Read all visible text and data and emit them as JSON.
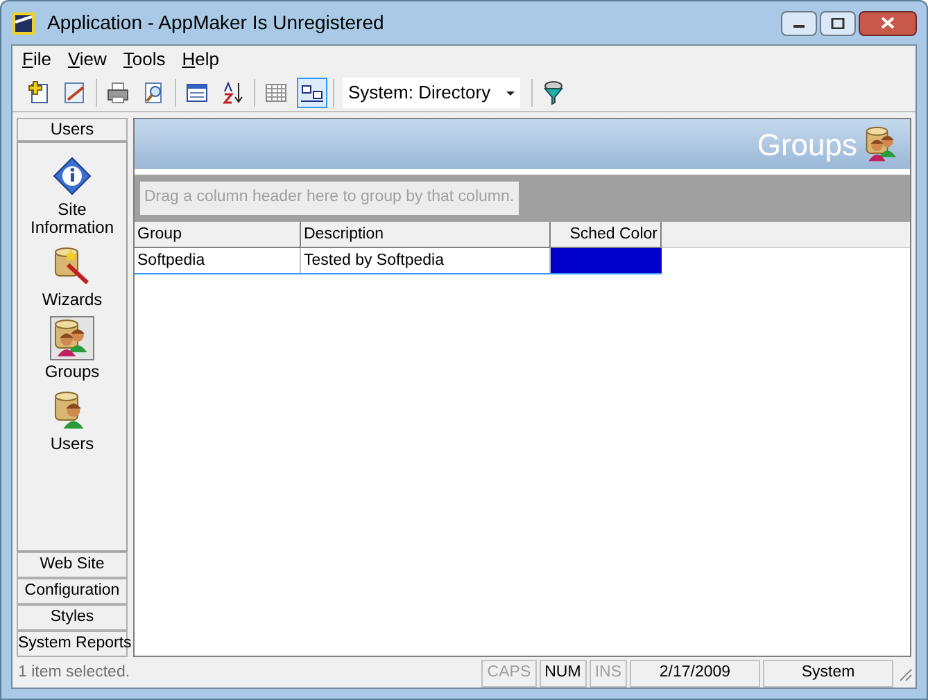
{
  "window": {
    "title": "Application - AppMaker Is Unregistered"
  },
  "menu": [
    "File",
    "View",
    "Tools",
    "Help"
  ],
  "toolbar": {
    "buttons": [
      {
        "kind": "new",
        "selected": false
      },
      {
        "kind": "edit",
        "selected": false
      },
      {
        "kind": "print",
        "selected": false
      },
      {
        "kind": "preview",
        "selected": false
      },
      {
        "kind": "calendar",
        "selected": false
      },
      {
        "kind": "sort",
        "selected": false
      },
      {
        "kind": "grid",
        "selected": false
      },
      {
        "kind": "groupbox",
        "selected": true
      }
    ],
    "combo": {
      "value": "System: Directory"
    }
  },
  "sidebar": {
    "header": "Users",
    "items": [
      {
        "label": "Site Information",
        "kind": "info",
        "selected": false
      },
      {
        "label": "Wizards",
        "kind": "wizard",
        "selected": false
      },
      {
        "label": "Groups",
        "kind": "groups",
        "selected": true
      },
      {
        "label": "Users",
        "kind": "user",
        "selected": false
      }
    ],
    "sections": [
      "Web Site",
      "Configuration",
      "Styles",
      "System Reports"
    ]
  },
  "header": {
    "title": "Groups"
  },
  "group_panel": {
    "placeholder": "Drag a column header here to group by that column."
  },
  "table": {
    "columns": [
      "Group",
      "Description",
      "Sched Color"
    ],
    "rows": [
      {
        "cells": [
          "Softpedia",
          "Tested by Softpedia"
        ],
        "color": "#0000cc",
        "selected": true
      }
    ]
  },
  "status_bar": {
    "message": "1 item selected.",
    "indicators": [
      {
        "label": "CAPS",
        "on": false
      },
      {
        "label": "NUM",
        "on": true
      },
      {
        "label": "INS",
        "on": false
      }
    ],
    "date": "2/17/2009",
    "user": "System"
  }
}
